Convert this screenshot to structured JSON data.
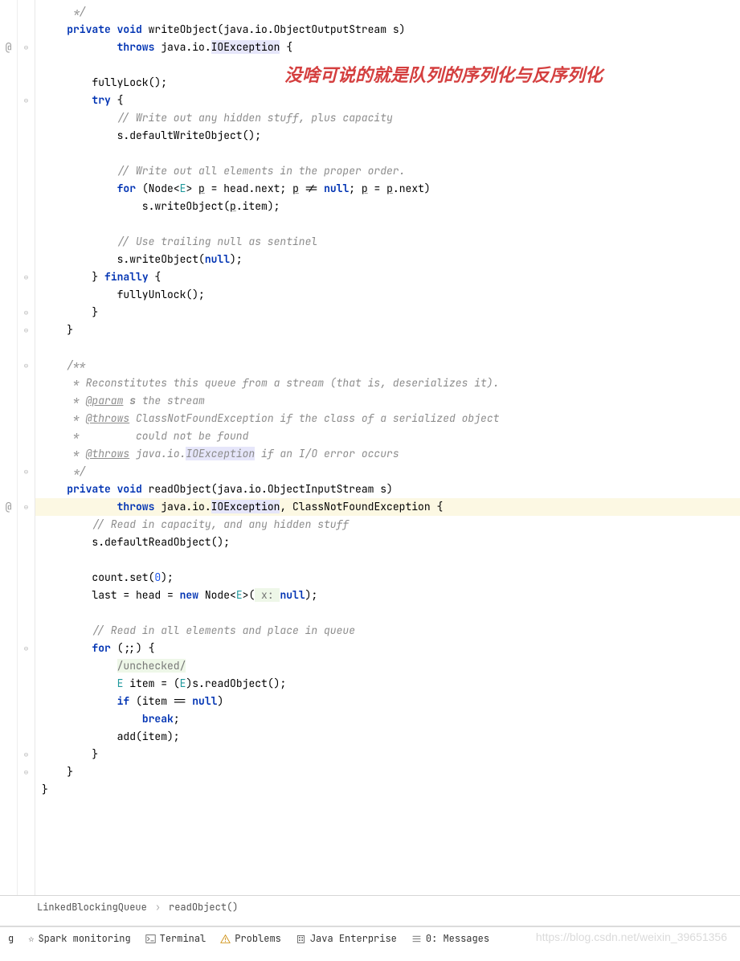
{
  "annotation": "没啥可说的就是队列的序列化与反序列化",
  "code": {
    "l1": "     */",
    "l2a": "private",
    "l2b": "void",
    "l2c": " writeObject(java.io.ObjectOutputStream s)",
    "l3a": "throws",
    "l3b": " java.io.",
    "l3c": "IOException",
    "l3d": " {",
    "l5": "        fullyLock();",
    "l6a": "try",
    "l6b": " {",
    "l7": "// Write out any hidden stuff, plus capacity",
    "l8": "            s.defaultWriteObject();",
    "l10": "// Write out all elements in the proper order.",
    "l11a": "for",
    "l11b": " (Node<",
    "l11c": "E",
    "l11d": "> ",
    "l11p": "p",
    "l11e": " = head.next; ",
    "l11f": " != ",
    "l11g": "null",
    "l11h": "; ",
    "l11i": " = ",
    "l11j": ".next)",
    "l12a": "                s.writeObject(",
    "l12b": ".item);",
    "l14": "// Use trailing null as sentinel",
    "l15a": "            s.writeObject(",
    "l15b": "null",
    "l15c": ");",
    "l16a": "        } ",
    "l16b": "finally",
    "l16c": " {",
    "l17": "            fullyUnlock();",
    "l18": "        }",
    "l19": "    }",
    "l21": "    /**",
    "l22": "     * Reconstitutes this queue from a stream (that is, deserializes it).",
    "l23a": "     * ",
    "l23b": "@param",
    "l23c": " s",
    "l23d": " the stream",
    "l24a": "     * ",
    "l24b": "@throws",
    "l24c": " ClassNotFoundException",
    "l24d": " if the class of a serialized object",
    "l25": "     *         could not be found",
    "l26a": "     * ",
    "l26b": "@throws",
    "l26c": " java.io.",
    "l26d": "IOException",
    "l26e": " if an I/O error occurs",
    "l27": "     */",
    "l28a": "private",
    "l28b": "void",
    "l28c": " readObject(java.io.ObjectInputStream s)",
    "l29a": "throws",
    "l29b": " java.io.",
    "l29c": "IOException",
    "l29d": ", ClassNotFoundException {",
    "l30": "// Read in capacity, and any hidden stuff",
    "l31": "        s.defaultReadObject();",
    "l33a": "        count.set(",
    "l33b": "0",
    "l33c": ");",
    "l34a": "        last = head = ",
    "l34b": "new",
    "l34c": " Node<",
    "l34d": "E",
    "l34e": ">(",
    "l34hint": " x: ",
    "l34f": "null",
    "l34g": ");",
    "l36": "// Read in all elements and place in queue",
    "l37a": "for",
    "l37b": " (;;) {",
    "l38": "/unchecked/",
    "l39a": "            ",
    "l39b": "E",
    "l39c": " item = (",
    "l39d": "E",
    "l39e": ")s.readObject();",
    "l40a": "if",
    "l40b": " (item == ",
    "l40c": "null",
    "l40d": ")",
    "l41a": "break",
    "l41b": ";",
    "l42": "            add(item);",
    "l43": "        }",
    "l44": "    }",
    "l45": "}"
  },
  "breadcrumb": {
    "class": "LinkedBlockingQueue",
    "method": "readObject()"
  },
  "status": {
    "spark": "Spark monitoring",
    "terminal": "Terminal",
    "problems": "Problems",
    "javaee": "Java Enterprise",
    "messages": "0: Messages"
  },
  "watermark": "https://blog.csdn.net/weixin_39651356"
}
